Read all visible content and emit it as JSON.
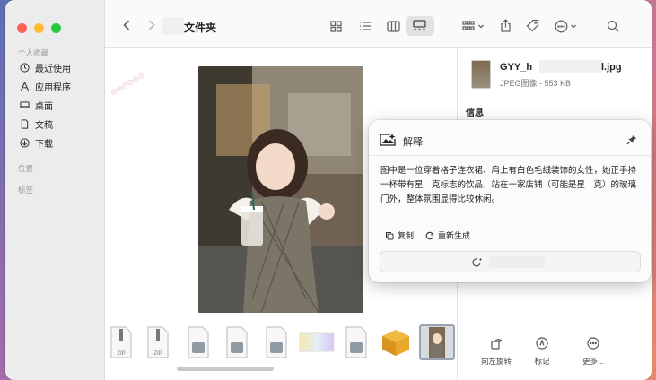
{
  "window": {
    "title": "文件夹"
  },
  "sidebar": {
    "sections": {
      "favorites": "个人收藏",
      "locations": "位置",
      "tags": "标签"
    },
    "items": [
      {
        "label": "最近使用",
        "icon": "clock-icon"
      },
      {
        "label": "应用程序",
        "icon": "applications-icon"
      },
      {
        "label": "桌面",
        "icon": "desktop-icon"
      },
      {
        "label": "文稿",
        "icon": "document-icon"
      },
      {
        "label": "下载",
        "icon": "download-icon"
      }
    ]
  },
  "filmstrip": {
    "thumbs": [
      {
        "label": "ZIP",
        "icon": "zip-file-icon"
      },
      {
        "label": "ZIP",
        "icon": "zip-file-icon"
      },
      {
        "label": "",
        "icon": "disk-image-icon"
      },
      {
        "label": "",
        "icon": "disk-image-icon"
      },
      {
        "label": "",
        "icon": "disk-image-icon"
      },
      {
        "label": "",
        "icon": "image-thumb-icon"
      },
      {
        "label": "",
        "icon": "disk-image-icon"
      },
      {
        "label": "",
        "icon": "package-icon"
      },
      {
        "label": "",
        "icon": "photo-thumb-icon"
      }
    ]
  },
  "inspector": {
    "file_name_start": "GYY_h",
    "file_name_end": "l.jpg",
    "file_meta": "JPEG图像 - 553 KB",
    "section_info": "信息",
    "actions": [
      {
        "label": "向左旋转",
        "icon": "rotate-left-icon"
      },
      {
        "label": "标记",
        "icon": "markup-icon"
      },
      {
        "label": "更多...",
        "icon": "more-icon"
      }
    ]
  },
  "popover": {
    "title": "解释",
    "body": "图中是一位穿着格子连衣裙、肩上有白色毛绒装饰的女性，她正手持一杯带有星　克标志的饮品，站在一家店铺（可能是星　克）的玻璃门外，整体氛围显得比较休闲。",
    "copy_label": "复制",
    "regenerate_label": "重新生成"
  },
  "colors": {
    "accent": "#007aff",
    "close": "#fe5f57",
    "minimize": "#febc2e",
    "zoom": "#28c840"
  }
}
